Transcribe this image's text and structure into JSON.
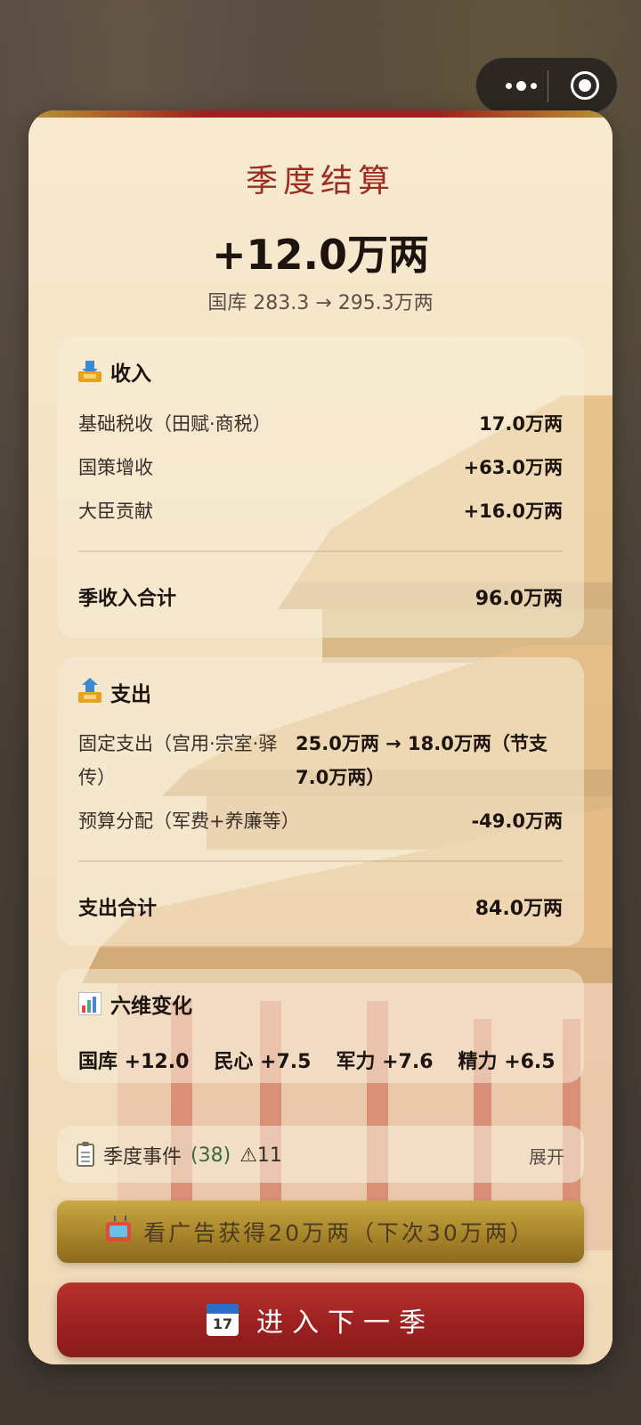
{
  "title": "季度结算",
  "delta": "+12.0万两",
  "treasury": "国库 283.3 → 295.3万两",
  "income": {
    "heading": "收入",
    "rows": [
      {
        "label": "基础税收（田赋·商税）",
        "value": "17.0万两"
      },
      {
        "label": "国策增收",
        "value": "+63.0万两"
      },
      {
        "label": "大臣贡献",
        "value": "+16.0万两"
      }
    ],
    "total_label": "季收入合计",
    "total_value": "96.0万两"
  },
  "expense": {
    "heading": "支出",
    "rows": [
      {
        "label": "固定支出（宫用·宗室·驿传）",
        "value": "25.0万两 → 18.0万两（节支7.0万两）"
      },
      {
        "label": "预算分配（军费+养廉等）",
        "value": "-49.0万两"
      }
    ],
    "total_label": "支出合计",
    "total_value": "84.0万两"
  },
  "six_dim": {
    "heading": "六维变化",
    "stats": [
      "国库 +12.0",
      "民心 +7.5",
      "军力 +7.6",
      "精力 +6.5"
    ]
  },
  "events": {
    "label": "季度事件",
    "count": "(38)",
    "warning": "⚠11",
    "expand": "展开"
  },
  "ad_button": "看广告获得20万两（下次30万两）",
  "next_button": "进入下一季",
  "calendar_icon_text": "17",
  "icons": {
    "income": "inbox-tray-icon",
    "expense": "outbox-tray-icon",
    "six_dim": "bar-chart-icon",
    "events": "clipboard-icon",
    "ad": "television-icon",
    "next": "calendar-icon"
  }
}
